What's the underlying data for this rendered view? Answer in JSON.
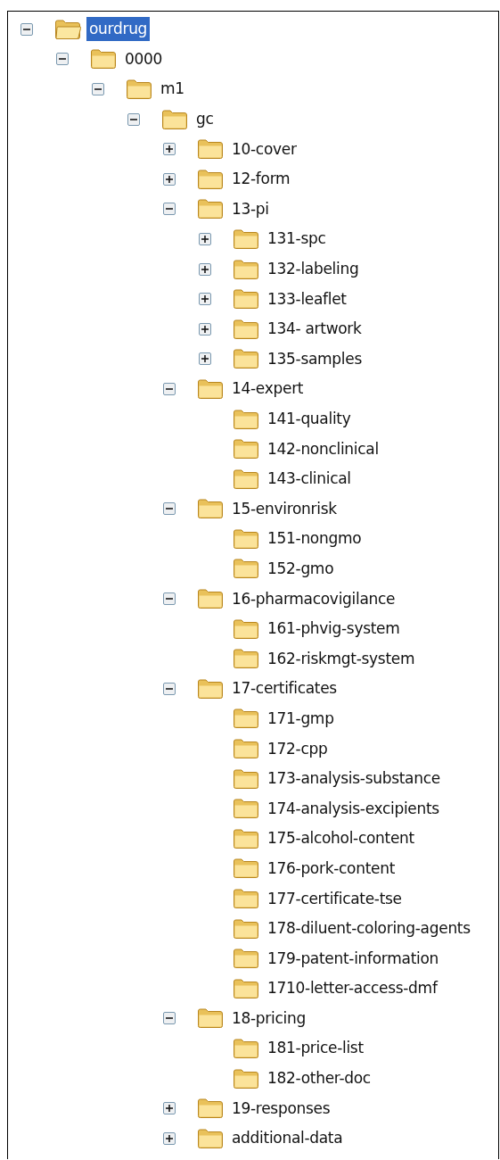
{
  "tree": [
    {
      "label": "ourdrug",
      "selected": true,
      "expanded": true,
      "children": [
        {
          "label": "0000",
          "selected": false,
          "expanded": true,
          "children": [
            {
              "label": "m1",
              "selected": false,
              "expanded": true,
              "children": [
                {
                  "label": "gc",
                  "selected": false,
                  "expanded": true,
                  "children": [
                    {
                      "label": "10-cover",
                      "selected": false,
                      "expanded": false
                    },
                    {
                      "label": "12-form",
                      "selected": false,
                      "expanded": false
                    },
                    {
                      "label": "13-pi",
                      "selected": false,
                      "expanded": true,
                      "children": [
                        {
                          "label": "131-spc",
                          "selected": false,
                          "expanded": false
                        },
                        {
                          "label": "132-labeling",
                          "selected": false,
                          "expanded": false
                        },
                        {
                          "label": "133-leaflet",
                          "selected": false,
                          "expanded": false
                        },
                        {
                          "label": "134- artwork",
                          "selected": false,
                          "expanded": false
                        },
                        {
                          "label": "135-samples",
                          "selected": false,
                          "expanded": false
                        }
                      ]
                    },
                    {
                      "label": "14-expert",
                      "selected": false,
                      "expanded": true,
                      "children": [
                        {
                          "label": "141-quality",
                          "selected": false
                        },
                        {
                          "label": "142-nonclinical",
                          "selected": false
                        },
                        {
                          "label": "143-clinical",
                          "selected": false
                        }
                      ]
                    },
                    {
                      "label": "15-environrisk",
                      "selected": false,
                      "expanded": true,
                      "children": [
                        {
                          "label": "151-nongmo",
                          "selected": false
                        },
                        {
                          "label": "152-gmo",
                          "selected": false
                        }
                      ]
                    },
                    {
                      "label": "16-pharmacovigilance",
                      "selected": false,
                      "expanded": true,
                      "children": [
                        {
                          "label": "161-phvig-system",
                          "selected": false
                        },
                        {
                          "label": "162-riskmgt-system",
                          "selected": false
                        }
                      ]
                    },
                    {
                      "label": "17-certificates",
                      "selected": false,
                      "expanded": true,
                      "children": [
                        {
                          "label": "171-gmp",
                          "selected": false
                        },
                        {
                          "label": "172-cpp",
                          "selected": false
                        },
                        {
                          "label": "173-analysis-substance",
                          "selected": false
                        },
                        {
                          "label": "174-analysis-excipients",
                          "selected": false
                        },
                        {
                          "label": "175-alcohol-content",
                          "selected": false
                        },
                        {
                          "label": "176-pork-content",
                          "selected": false
                        },
                        {
                          "label": "177-certificate-tse",
                          "selected": false
                        },
                        {
                          "label": "178-diluent-coloring-agents",
                          "selected": false
                        },
                        {
                          "label": "179-patent-information",
                          "selected": false
                        },
                        {
                          "label": "1710-letter-access-dmf",
                          "selected": false
                        }
                      ]
                    },
                    {
                      "label": "18-pricing",
                      "selected": false,
                      "expanded": true,
                      "children": [
                        {
                          "label": "181-price-list",
                          "selected": false
                        },
                        {
                          "label": "182-other-doc",
                          "selected": false
                        }
                      ]
                    },
                    {
                      "label": "19-responses",
                      "selected": false,
                      "expanded": false
                    },
                    {
                      "label": "additional-data",
                      "selected": false,
                      "expanded": false
                    }
                  ]
                }
              ]
            }
          ]
        }
      ]
    }
  ]
}
